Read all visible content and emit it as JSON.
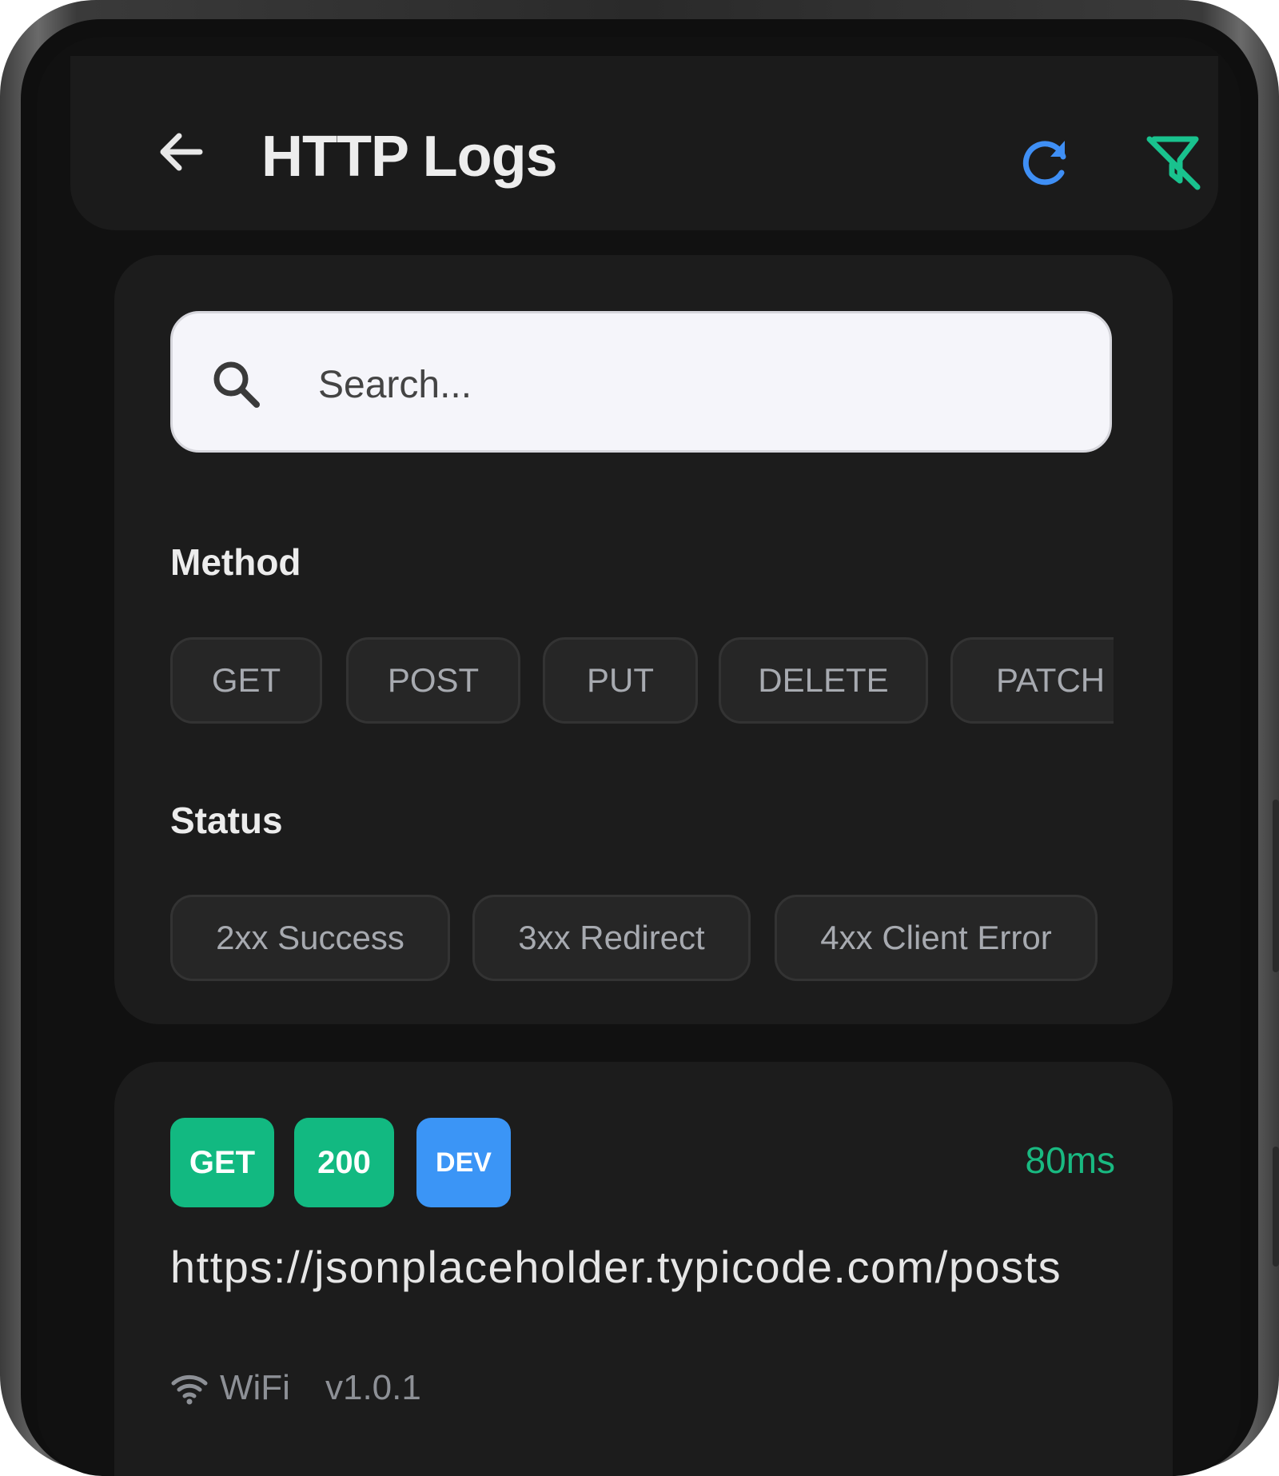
{
  "app_bar": {
    "title": "HTTP Logs",
    "icons": [
      "back-arrow-icon",
      "refresh-icon",
      "filter-off-icon"
    ],
    "colors": {
      "refresh": "#3f8ff5",
      "filter_off": "#19c28e"
    }
  },
  "filters": {
    "search": {
      "placeholder": "Search...",
      "value": ""
    },
    "method_label": "Method",
    "methods": [
      "GET",
      "POST",
      "PUT",
      "DELETE",
      "PATCH"
    ],
    "status_label": "Status",
    "statuses": [
      "2xx Success",
      "3xx Redirect",
      "4xx Client Error"
    ]
  },
  "log_entry": {
    "method": "GET",
    "status_code": "200",
    "environment": "DEV",
    "duration": "80ms",
    "url": "https://jsonplaceholder.typicode.com/posts",
    "network": "WiFi",
    "app_version": "v1.0.1",
    "colors": {
      "method_badge": "#12b981",
      "status_badge": "#12b981",
      "env_badge": "#3b95f6",
      "duration_text": "#19b981"
    }
  }
}
